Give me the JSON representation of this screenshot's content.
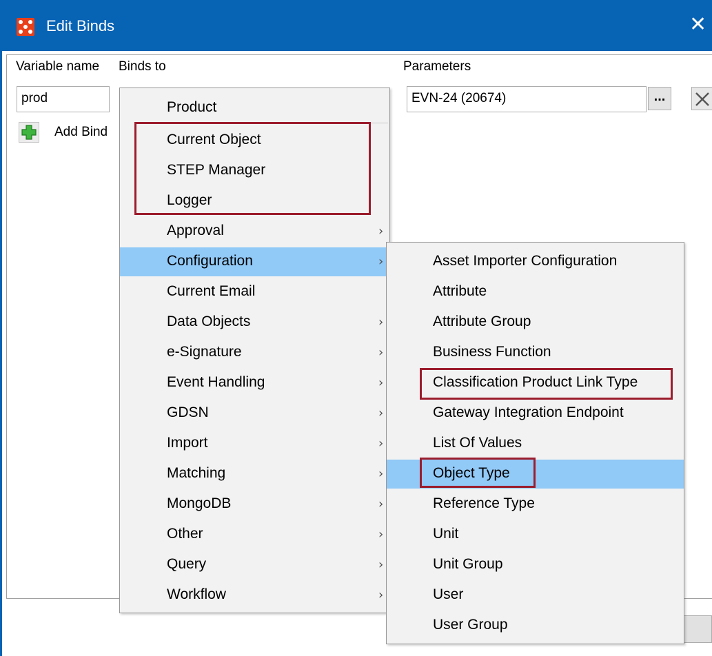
{
  "window": {
    "title": "Edit Binds",
    "close_icon": "close-icon",
    "app_icon": "step-app-icon"
  },
  "headers": {
    "variable_name": "Variable name",
    "binds_to": "Binds to",
    "parameters": "Parameters"
  },
  "bind_row": {
    "variable_name": "prod",
    "parameter_value": "EVN-24 (20674)",
    "browse_label": "...",
    "delete_icon": "delete-x-icon"
  },
  "add_bind": {
    "label": "Add Bind",
    "icon": "green-plus-icon"
  },
  "binds_menu": {
    "items": [
      {
        "label": "Product",
        "submenu": false
      },
      {
        "label": "Current Object",
        "submenu": false
      },
      {
        "label": "STEP Manager",
        "submenu": false
      },
      {
        "label": "Logger",
        "submenu": false
      },
      {
        "label": "Approval",
        "submenu": true
      },
      {
        "label": "Configuration",
        "submenu": true,
        "highlighted": true
      },
      {
        "label": "Current Email",
        "submenu": false
      },
      {
        "label": "Data Objects",
        "submenu": true
      },
      {
        "label": "e-Signature",
        "submenu": true
      },
      {
        "label": "Event Handling",
        "submenu": true
      },
      {
        "label": "GDSN",
        "submenu": true
      },
      {
        "label": "Import",
        "submenu": true
      },
      {
        "label": "Matching",
        "submenu": true
      },
      {
        "label": "MongoDB",
        "submenu": true
      },
      {
        "label": "Other",
        "submenu": true
      },
      {
        "label": "Query",
        "submenu": true
      },
      {
        "label": "Workflow",
        "submenu": true
      }
    ],
    "arrow_glyph": "›"
  },
  "configuration_submenu": {
    "items": [
      {
        "label": "Asset Importer Configuration"
      },
      {
        "label": "Attribute"
      },
      {
        "label": "Attribute Group"
      },
      {
        "label": "Business Function"
      },
      {
        "label": "Classification Product Link Type"
      },
      {
        "label": "Gateway Integration Endpoint"
      },
      {
        "label": "List Of Values"
      },
      {
        "label": "Object Type",
        "highlighted": true
      },
      {
        "label": "Reference Type"
      },
      {
        "label": "Unit"
      },
      {
        "label": "Unit Group"
      },
      {
        "label": "User"
      },
      {
        "label": "User Group"
      }
    ]
  },
  "colors": {
    "titlebar": "#0763b4",
    "menu_highlight": "#91c9f7",
    "annotation_box": "#9b1c2c",
    "app_icon": "#e8401a",
    "add_icon": "#3fb43f"
  }
}
